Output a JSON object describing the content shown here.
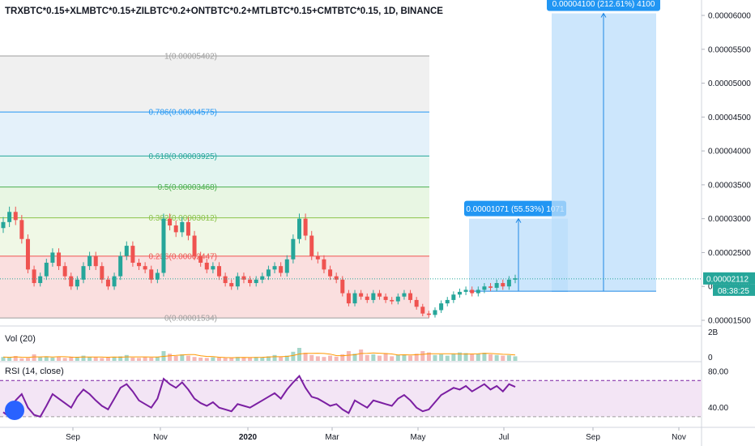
{
  "title": "TRXBTC*0.15+XLMBTC*0.15+ZILBTC*0.2+ONTBTC*0.2+MTLBTC*0.15+CMTBTC*0.15, 1D, BINANCE",
  "colors": {
    "candle_up": "#26a69a",
    "candle_down": "#ef5350",
    "rsi_line": "#7b1fa2",
    "rsi_band_fill": "#f3e5f5",
    "projection_fill": "#bbdefb",
    "projection_line": "#1e88e5",
    "price_label_bg": "#26a69a",
    "projection_label_bg": "#2196f3"
  },
  "chart_data": {
    "type": "candlestick",
    "x_ticks": [
      "Sep",
      "Nov",
      "2020",
      "Mar",
      "May",
      "Jul",
      "Sep",
      "Nov"
    ],
    "y_axis": {
      "ylim": [
        1.46e-05,
        6.3e-06
      ],
      "ticks": [
        "0.00001500",
        "0.00002000",
        "0.00002500",
        "0.00003000",
        "0.00003500",
        "0.00004000",
        "0.00004500",
        "0.00005000",
        "0.00005500",
        "0.00006000"
      ]
    },
    "price": {
      "last_value": 2.112e-05,
      "last_label": "0.00002112",
      "countdown": "08:38:25",
      "close_series": [
        2.95e-05,
        3.1e-05,
        2.98e-05,
        2.7e-05,
        2.25e-05,
        2.05e-05,
        2.15e-05,
        2.35e-05,
        2.5e-05,
        2.3e-05,
        2.15e-05,
        2e-05,
        2.1e-05,
        2.3e-05,
        2.45e-05,
        2.3e-05,
        2.1e-05,
        2e-05,
        2.15e-05,
        2.45e-05,
        2.6e-05,
        2.35e-05,
        2.3e-05,
        2.25e-05,
        2.1e-05,
        2.2e-05,
        3e-05,
        2.9e-05,
        2.8e-05,
        2.95e-05,
        2.75e-05,
        2.45e-05,
        2.35e-05,
        2.25e-05,
        2.3e-05,
        2.15e-05,
        2.05e-05,
        2e-05,
        2.15e-05,
        2.1e-05,
        2.05e-05,
        2.1e-05,
        2.15e-05,
        2.25e-05,
        2.3e-05,
        2.2e-05,
        2.4e-05,
        2.7e-05,
        3e-05,
        2.75e-05,
        2.45e-05,
        2.4e-05,
        2.25e-05,
        2.15e-05,
        2.1e-05,
        1.9e-05,
        1.75e-05,
        1.9e-05,
        1.85e-05,
        1.8e-05,
        1.9e-05,
        1.85e-05,
        1.8e-05,
        1.78e-05,
        1.85e-05,
        1.9e-05,
        1.8e-05,
        1.7e-05,
        1.6e-05,
        1.58e-05,
        1.65e-05,
        1.75e-05,
        1.8e-05,
        1.88e-05,
        1.92e-05,
        1.95e-05,
        1.9e-05,
        1.95e-05,
        2e-05,
        1.98e-05,
        2.05e-05,
        2e-05,
        2.1e-05,
        2.12e-05
      ]
    },
    "fibonacci": [
      {
        "label": "1(0.00005402)",
        "value": 5.402e-05
      },
      {
        "label": "0.786(0.00004575)",
        "value": 4.575e-05
      },
      {
        "label": "0.618(0.00003925)",
        "value": 3.925e-05
      },
      {
        "label": "0.5(0.00003468)",
        "value": 3.468e-05
      },
      {
        "label": "0.382(0.00003012)",
        "value": 3.012e-05
      },
      {
        "label": "0.236(0.00002447)",
        "value": 2.447e-05
      },
      {
        "label": "0(0.00001534)",
        "value": 1.534e-05
      }
    ],
    "projections": [
      {
        "label": "0.00001071 (55.53%) 1071",
        "from": 1.93e-05,
        "to": 3e-05
      },
      {
        "label": "0.00004100 (212.61%) 4100",
        "from": 1.93e-05,
        "to": 6.03e-05
      }
    ],
    "volume": {
      "label": "Vol (20)",
      "ticks": [
        "2B",
        "0"
      ],
      "values": [
        0.12,
        0.1,
        0.15,
        0.08,
        0.09,
        0.2,
        0.11,
        0.14,
        0.1,
        0.12,
        0.09,
        0.13,
        0.1,
        0.16,
        0.12,
        0.11,
        0.09,
        0.1,
        0.12,
        0.14,
        0.18,
        0.1,
        0.09,
        0.11,
        0.1,
        0.12,
        0.3,
        0.22,
        0.15,
        0.2,
        0.16,
        0.12,
        0.1,
        0.09,
        0.11,
        0.1,
        0.09,
        0.1,
        0.12,
        0.11,
        0.1,
        0.12,
        0.11,
        0.14,
        0.18,
        0.12,
        0.16,
        0.28,
        0.4,
        0.25,
        0.18,
        0.14,
        0.12,
        0.16,
        0.13,
        0.2,
        0.3,
        0.22,
        0.35,
        0.18,
        0.2,
        0.16,
        0.24,
        0.14,
        0.18,
        0.2,
        0.16,
        0.22,
        0.3,
        0.26,
        0.18,
        0.2,
        0.16,
        0.22,
        0.26,
        0.24,
        0.2,
        0.22,
        0.25,
        0.2,
        0.18,
        0.16,
        0.17,
        0.14
      ]
    },
    "rsi": {
      "label": "RSI (14, close)",
      "ticks": [
        "80.00",
        "40.00"
      ],
      "upper": 70,
      "lower": 30,
      "values": [
        35,
        30,
        48,
        55,
        40,
        32,
        30,
        42,
        55,
        50,
        45,
        40,
        52,
        60,
        55,
        48,
        42,
        38,
        50,
        62,
        66,
        58,
        48,
        44,
        40,
        50,
        72,
        66,
        62,
        68,
        60,
        50,
        45,
        42,
        46,
        40,
        38,
        36,
        44,
        42,
        40,
        44,
        48,
        52,
        56,
        50,
        60,
        68,
        75,
        62,
        52,
        50,
        46,
        42,
        44,
        38,
        34,
        48,
        44,
        40,
        48,
        46,
        44,
        42,
        50,
        54,
        48,
        40,
        36,
        38,
        46,
        54,
        58,
        62,
        60,
        64,
        58,
        62,
        66,
        60,
        64,
        58,
        66,
        63
      ]
    }
  }
}
